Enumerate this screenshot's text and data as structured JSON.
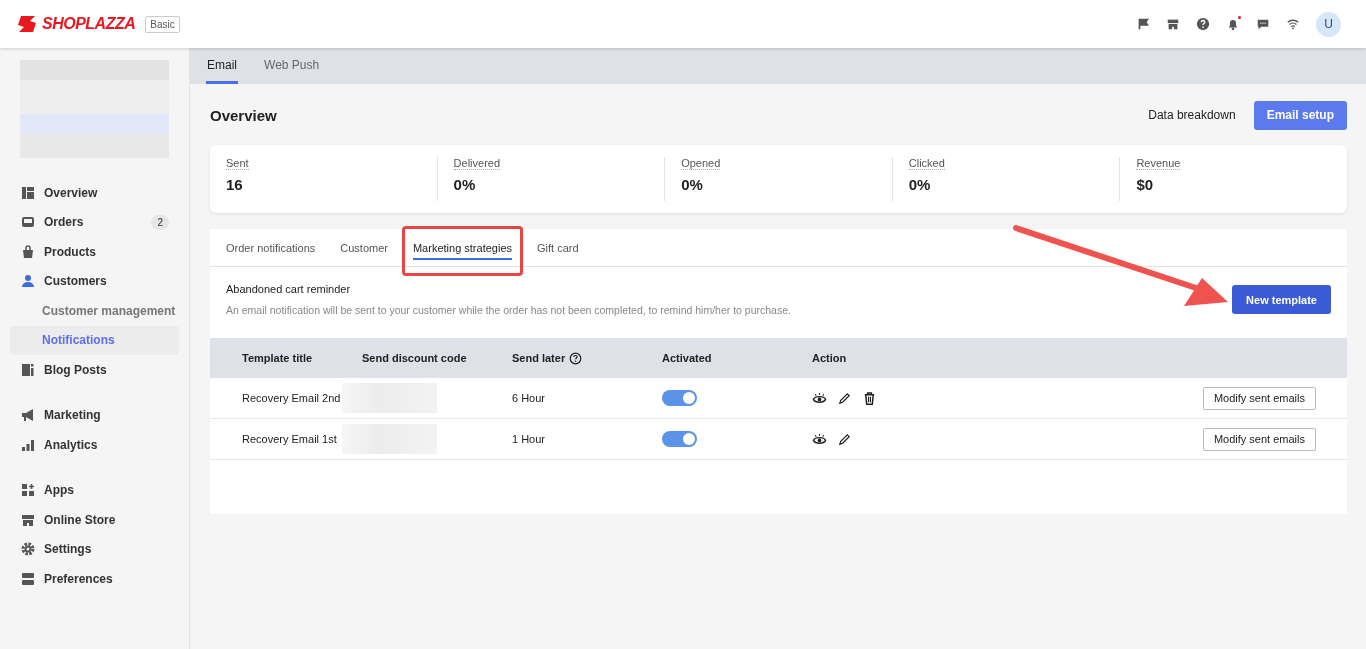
{
  "header": {
    "logo": "SHOPLAZZA",
    "plan": "Basic",
    "notification_unread": true,
    "avatar": "U"
  },
  "sidebar": {
    "groups": [
      [
        {
          "label": "Overview",
          "selected": false
        },
        {
          "label": "Orders",
          "selected": false,
          "count": "2"
        },
        {
          "label": "Products",
          "selected": false
        },
        {
          "label": "Customers",
          "selected": true,
          "children": [
            {
              "label": "Customer management",
              "selected": false
            },
            {
              "label": "Notifications",
              "selected": true
            }
          ]
        },
        {
          "label": "Blog Posts",
          "selected": false
        }
      ],
      [
        {
          "label": "Marketing",
          "selected": false
        },
        {
          "label": "Analytics",
          "selected": false
        }
      ],
      [
        {
          "label": "Apps",
          "selected": false
        },
        {
          "label": "Online Store",
          "selected": false
        },
        {
          "label": "Settings",
          "selected": false
        },
        {
          "label": "Preferences",
          "selected": false
        }
      ]
    ]
  },
  "channel_tabs": [
    {
      "label": "Email",
      "selected": true
    },
    {
      "label": "Web Push",
      "selected": false
    }
  ],
  "overview": {
    "title": "Overview",
    "link": "Data breakdown",
    "button": "Email setup"
  },
  "stats": [
    {
      "label": "Sent",
      "value": "16"
    },
    {
      "label": "Delivered",
      "value": "0%"
    },
    {
      "label": "Opened",
      "value": "0%"
    },
    {
      "label": "Clicked",
      "value": "0%"
    },
    {
      "label": "Revenue",
      "value": "$0"
    }
  ],
  "category_tabs": [
    {
      "label": "Order notifications",
      "selected": false,
      "highlighted": false
    },
    {
      "label": "Customer",
      "selected": false,
      "highlighted": false
    },
    {
      "label": "Marketing strategies",
      "selected": true,
      "highlighted": true
    },
    {
      "label": "Gift card",
      "selected": false,
      "highlighted": false
    }
  ],
  "section": {
    "title": "Abandoned cart reminder",
    "description": "An email notification will be sent to your customer while the order has not been completed, to remind him/her to purchase.",
    "button": "New template"
  },
  "table": {
    "columns": [
      "Template title",
      "Send discount code",
      "Send later",
      "Activated",
      "Action"
    ],
    "rows": [
      {
        "title": "Recovery Email 2nd",
        "send_later": "6 Hour",
        "activated": true,
        "deletable": true,
        "button": "Modify sent emails"
      },
      {
        "title": "Recovery Email 1st",
        "send_later": "1 Hour",
        "activated": true,
        "deletable": false,
        "button": "Modify sent emails"
      }
    ]
  }
}
